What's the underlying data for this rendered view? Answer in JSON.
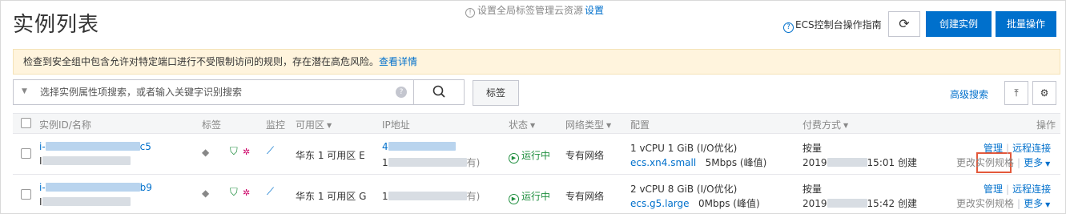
{
  "page": {
    "title": "实例列表",
    "tag_tip": "设置全局标签管理云资源",
    "tag_tip_link": "设置",
    "guide": "ECS控制台操作指南",
    "refresh_icon": "refresh-icon",
    "create_label": "创建实例",
    "batch_label": "批量操作"
  },
  "alert": {
    "text": "检查到安全组中包含允许对特定端口进行不受限制访问的规则，存在潜在高危风险。",
    "link": "查看详情"
  },
  "search": {
    "placeholder": "选择实例属性项搜索，或者输入关键字识别搜索",
    "tag_label": "标签",
    "advanced": "高级搜索"
  },
  "table": {
    "headers": {
      "id": "实例ID/名称",
      "tag": "标签",
      "monitor": "监控",
      "zone": "可用区",
      "ip": "IP地址",
      "status": "状态",
      "network": "网络类型",
      "config": "配置",
      "billing": "付费方式",
      "action": "操作"
    },
    "rows": [
      {
        "id_prefix": "i-",
        "id_suffix": "c5",
        "name_prefix": "I",
        "zone": "华东 1 可用区 E",
        "ip_prefix": "4",
        "ip2_prefix": "1",
        "ip2_suffix": "有)",
        "status": "运行中",
        "network": "专有网络",
        "config_line1": "1 vCPU 1 GiB (I/O优化)",
        "instance_type": "ecs.xn4.small",
        "bandwidth": "5Mbps (峰值)",
        "billing": "按量",
        "created_prefix": "2019",
        "created_time": "15:01 创建",
        "manage": "管理",
        "remote": "远程连接",
        "change_spec": "更改实例规格",
        "more": "更多"
      },
      {
        "id_prefix": "i-",
        "id_suffix": "b9",
        "name_prefix": "I",
        "zone": "华东 1 可用区 G",
        "ip_prefix": "1",
        "ip2_prefix": "",
        "ip2_suffix": "有)",
        "status": "运行中",
        "network": "专有网络",
        "config_line1": "2 vCPU 8 GiB (I/O优化)",
        "instance_type": "ecs.g5.large",
        "bandwidth": "0Mbps (峰值)",
        "billing": "按量",
        "created_prefix": "2019",
        "created_time": "15:42 创建",
        "manage": "管理",
        "remote": "远程连接",
        "change_spec": "更改实例规格",
        "more": "更多"
      }
    ]
  },
  "colors": {
    "primary": "#0070cc",
    "alert_bg": "#fff4dd",
    "running": "#1e8e3e",
    "highlight": "#e4593b"
  }
}
